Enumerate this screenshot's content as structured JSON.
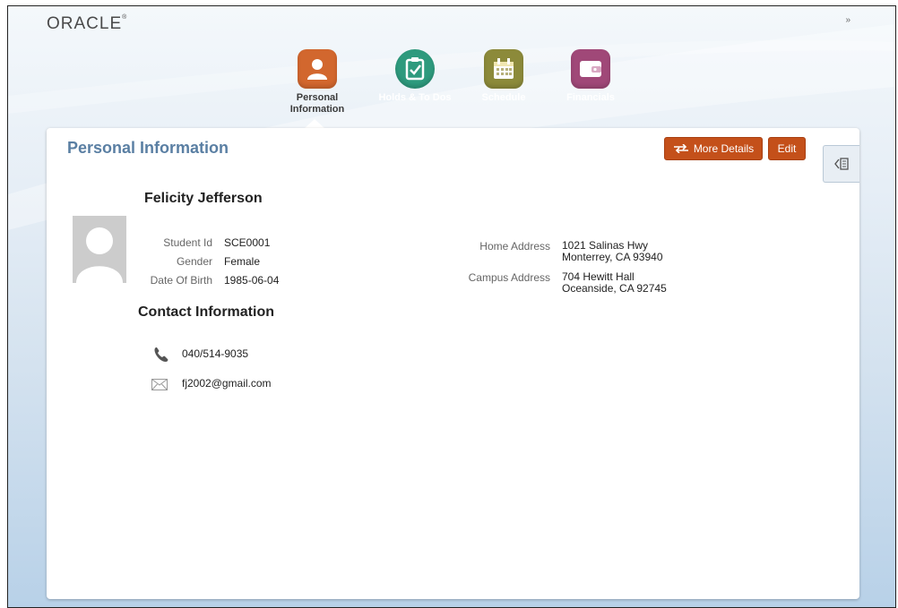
{
  "brand": "ORACLE",
  "collapse_glyph": "»",
  "nav": {
    "items": [
      {
        "line1": "Personal",
        "line2": "Information",
        "color": "#d2672e",
        "icon": "person-icon",
        "active": true
      },
      {
        "line1": "Holds & To Dos",
        "line2": "",
        "color": "#2e9a7d",
        "icon": "checklist-icon",
        "active": false
      },
      {
        "line1": "Schedule",
        "line2": "",
        "color": "#8c8a3a",
        "icon": "calendar-icon",
        "active": false
      },
      {
        "line1": "Financials",
        "line2": "",
        "color": "#a04878",
        "icon": "wallet-icon",
        "active": false
      }
    ]
  },
  "panel": {
    "title": "Personal Information",
    "more_details_label": "More Details",
    "edit_label": "Edit"
  },
  "student": {
    "name": "Felicity Jefferson",
    "fields": [
      {
        "label": "Student Id",
        "value": "SCE0001"
      },
      {
        "label": "Gender",
        "value": "Female"
      },
      {
        "label": "Date Of Birth",
        "value": "1985-06-04"
      }
    ],
    "home_address_label": "Home Address",
    "home_address_line1": "1021 Salinas Hwy",
    "home_address_line2": "Monterrey, CA 93940",
    "campus_address_label": "Campus Address",
    "campus_address_line1": "704 Hewitt Hall",
    "campus_address_line2": "Oceanside, CA 92745"
  },
  "contact": {
    "title": "Contact Information",
    "phone": "040/514-9035",
    "email": "fj2002@gmail.com"
  },
  "colors": {
    "accent_button": "#c4501a",
    "title_blue": "#5a7fa3"
  }
}
